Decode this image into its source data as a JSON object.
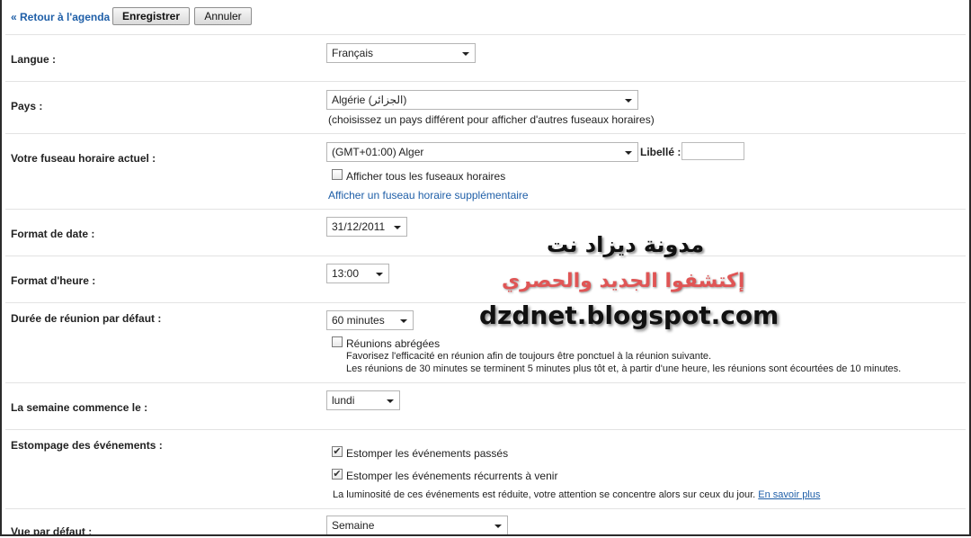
{
  "toolbar": {
    "back_link": "« Retour à l'agenda",
    "save_label": "Enregistrer",
    "cancel_label": "Annuler"
  },
  "language": {
    "label": "Langue :",
    "value": "Français"
  },
  "country": {
    "label": "Pays :",
    "value": "Algérie (الجزائر)",
    "hint": "(choisissez un pays différent pour afficher d'autres fuseaux horaires)"
  },
  "timezone": {
    "label": "Votre fuseau horaire actuel :",
    "value": "(GMT+01:00) Alger",
    "libelle_label": "Libellé :",
    "show_all_label": "Afficher tous les fuseaux horaires",
    "show_all_checked": false,
    "additional_link": "Afficher un fuseau horaire supplémentaire"
  },
  "date_format": {
    "label": "Format de date :",
    "value": "31/12/2011"
  },
  "time_format": {
    "label": "Format d'heure :",
    "value": "13:00"
  },
  "meeting_duration": {
    "label": "Durée de réunion par défaut :",
    "value": "60 minutes",
    "short_meetings_label": "Réunions abrégées",
    "short_meetings_checked": false,
    "desc_line1": "Favorisez l'efficacité en réunion afin de toujours être ponctuel à la réunion suivante.",
    "desc_line2": "Les réunions de 30 minutes se terminent 5 minutes plus tôt et, à partir d'une heure, les réunions sont écourtées de 10 minutes."
  },
  "week_start": {
    "label": "La semaine commence le :",
    "value": "lundi"
  },
  "event_dimming": {
    "label": "Estompage des événements :",
    "past_label": "Estomper les événements passés",
    "past_checked": true,
    "recurring_label": "Estomper les événements récurrents à venir",
    "recurring_checked": true,
    "desc": "La luminosité de ces événements est réduite, votre attention se concentre alors sur ceux du jour.",
    "learn_more": "En savoir plus"
  },
  "default_view": {
    "label": "Vue par défaut :",
    "value": "Semaine"
  },
  "watermark": {
    "line1": "مدونة ديزاد نت",
    "line2": "إكتشفوا الجديد والحصري",
    "line3": "dzdnet.blogspot.com"
  },
  "colors": {
    "link": "#1f5fa8",
    "watermark_red": "#e05555"
  }
}
